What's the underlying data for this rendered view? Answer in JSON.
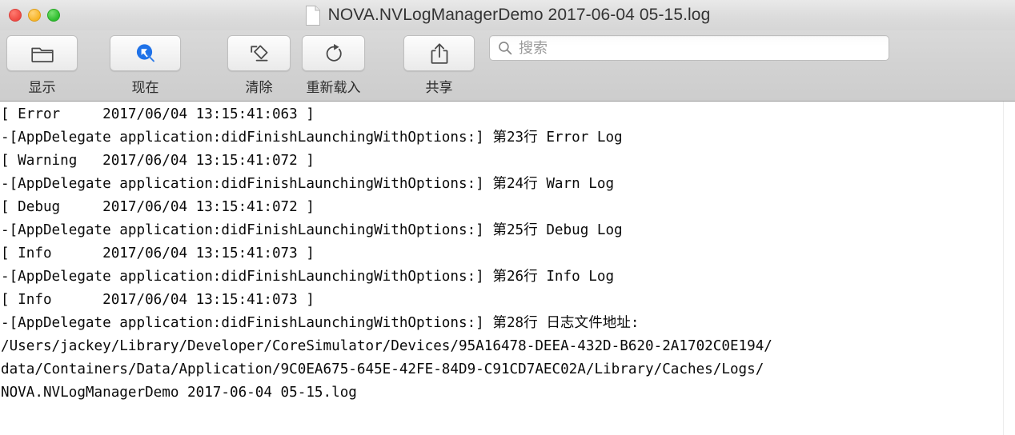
{
  "window": {
    "title": "NOVA.NVLogManagerDemo 2017-06-04 05-15.log",
    "traffic_lights": {
      "close_label": "close",
      "minimize_label": "minimize",
      "maximize_label": "maximize"
    },
    "doc_icon": "document-icon"
  },
  "toolbar": {
    "items": [
      {
        "id": "show",
        "label": "显示",
        "icon": "folder-icon"
      },
      {
        "id": "now",
        "label": "现在",
        "icon": "now-cursor-icon"
      },
      {
        "id": "clear",
        "label": "清除",
        "icon": "clear-icon"
      },
      {
        "id": "reload",
        "label": "重新载入",
        "icon": "reload-icon"
      },
      {
        "id": "share",
        "label": "共享",
        "icon": "share-icon"
      }
    ],
    "search": {
      "placeholder": "搜索",
      "value": "",
      "icon": "search-icon"
    }
  },
  "log": {
    "lines": [
      "[ Error     2017/06/04 13:15:41:063 ]",
      "-[AppDelegate application:didFinishLaunchingWithOptions:] 第23行 Error Log",
      "[ Warning   2017/06/04 13:15:41:072 ]",
      "-[AppDelegate application:didFinishLaunchingWithOptions:] 第24行 Warn Log",
      "[ Debug     2017/06/04 13:15:41:072 ]",
      "-[AppDelegate application:didFinishLaunchingWithOptions:] 第25行 Debug Log",
      "[ Info      2017/06/04 13:15:41:073 ]",
      "-[AppDelegate application:didFinishLaunchingWithOptions:] 第26行 Info Log",
      "[ Info      2017/06/04 13:15:41:073 ]",
      "-[AppDelegate application:didFinishLaunchingWithOptions:] 第28行 日志文件地址:",
      "/Users/jackey/Library/Developer/CoreSimulator/Devices/95A16478-DEEA-432D-B620-2A1702C0E194/",
      "data/Containers/Data/Application/9C0EA675-645E-42FE-84D9-C91CD7AEC02A/Library/Caches/Logs/",
      "NOVA.NVLogManagerDemo 2017-06-04 05-15.log"
    ],
    "text": "[ Error     2017/06/04 13:15:41:063 ]\n-[AppDelegate application:didFinishLaunchingWithOptions:] 第23行 Error Log\n[ Warning   2017/06/04 13:15:41:072 ]\n-[AppDelegate application:didFinishLaunchingWithOptions:] 第24行 Warn Log\n[ Debug     2017/06/04 13:15:41:072 ]\n-[AppDelegate application:didFinishLaunchingWithOptions:] 第25行 Debug Log\n[ Info      2017/06/04 13:15:41:073 ]\n-[AppDelegate application:didFinishLaunchingWithOptions:] 第26行 Info Log\n[ Info      2017/06/04 13:15:41:073 ]\n-[AppDelegate application:didFinishLaunchingWithOptions:] 第28行 日志文件地址:\n/Users/jackey/Library/Developer/CoreSimulator/Devices/95A16478-DEEA-432D-B620-2A1702C0E194/\ndata/Containers/Data/Application/9C0EA675-645E-42FE-84D9-C91CD7AEC02A/Library/Caches/Logs/\nNOVA.NVLogManagerDemo 2017-06-04 05-15.log"
  },
  "colors": {
    "titlebar_top": "#e9e9e9",
    "toolbar": "#d2d2d2",
    "log_background": "#ffffff",
    "log_text": "#0a0a0a",
    "accent_blue": "#1f72e8",
    "close_red": "#f04a42",
    "minimize_yellow": "#f7b527",
    "maximize_green": "#2ebd2e"
  }
}
